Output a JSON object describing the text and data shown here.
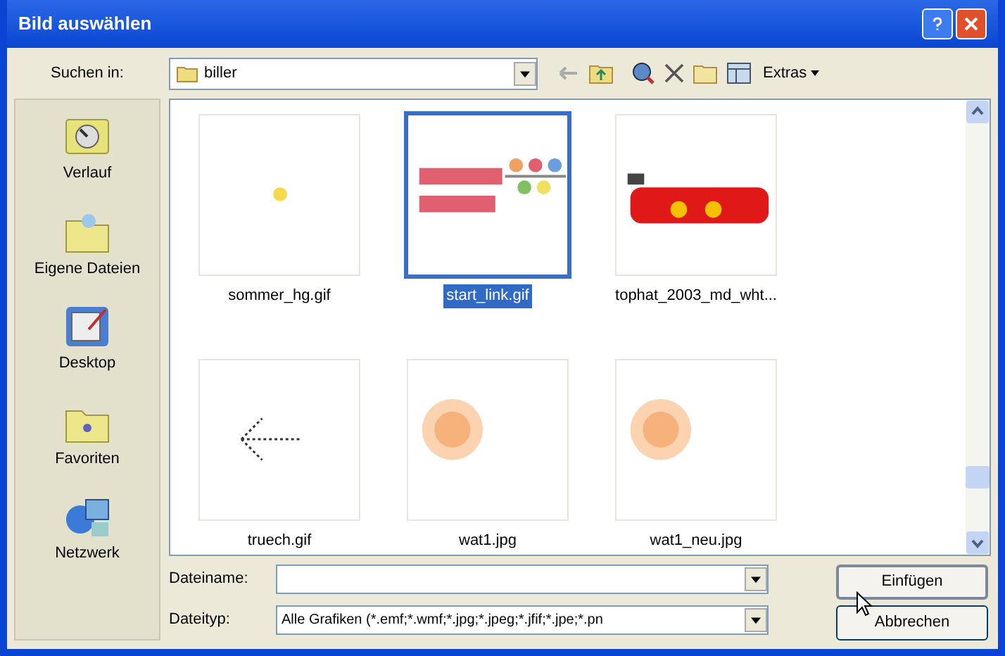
{
  "window": {
    "title": "Bild auswählen"
  },
  "toolbar": {
    "look_in_label": "Suchen in:",
    "folder": "biller",
    "extras": "Extras"
  },
  "places": [
    {
      "label": "Verlauf",
      "kind": "history"
    },
    {
      "label": "Eigene Dateien",
      "kind": "documents"
    },
    {
      "label": "Desktop",
      "kind": "desktop"
    },
    {
      "label": "Favoriten",
      "kind": "favorites"
    },
    {
      "label": "Netzwerk",
      "kind": "network"
    }
  ],
  "files": [
    {
      "name": "sommer_hg.gif",
      "kind": "dot",
      "selected": false
    },
    {
      "name": "start_link.gif",
      "kind": "logo",
      "selected": true
    },
    {
      "name": "tophat_2003_md_wht...",
      "kind": "hat",
      "selected": false
    },
    {
      "name": "truech.gif",
      "kind": "arrow",
      "selected": false
    },
    {
      "name": "wat1.jpg",
      "kind": "glow",
      "selected": false
    },
    {
      "name": "wat1_neu.jpg",
      "kind": "glow",
      "selected": false
    }
  ],
  "filename": {
    "label": "Dateiname:"
  },
  "filetype": {
    "label": "Dateityp:",
    "value": "Alle Grafiken (*.emf;*.wmf;*.jpg;*.jpeg;*.jfif;*.jpe;*.pn"
  },
  "buttons": [
    "Einfügen",
    "Abbrechen"
  ]
}
